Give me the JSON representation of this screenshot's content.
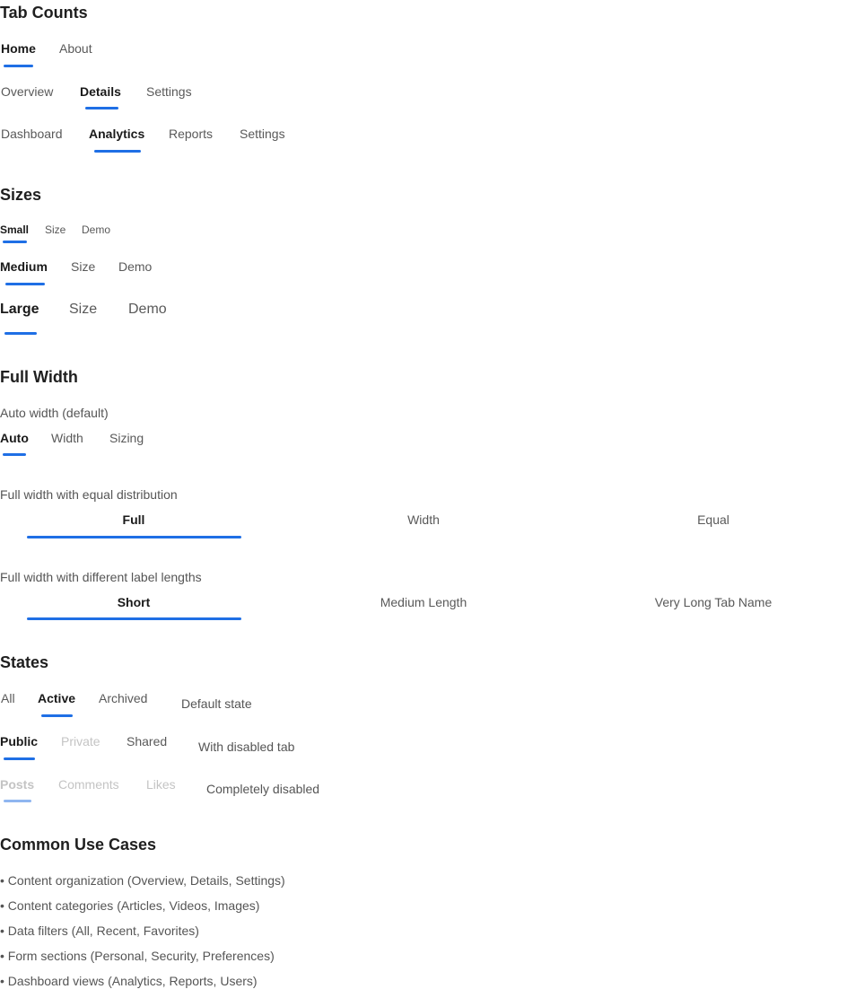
{
  "sections": {
    "tab_counts": "Tab Counts",
    "sizes": "Sizes",
    "full_width": "Full Width",
    "states": "States",
    "use_cases": "Common Use Cases"
  },
  "tab_counts": {
    "row2": [
      "Home",
      "About"
    ],
    "row3": [
      "Overview",
      "Details",
      "Settings"
    ],
    "row4": [
      "Dashboard",
      "Analytics",
      "Reports",
      "Settings"
    ]
  },
  "sizes": {
    "small": [
      "Small",
      "Size",
      "Demo"
    ],
    "medium": [
      "Medium",
      "Size",
      "Demo"
    ],
    "large": [
      "Large",
      "Size",
      "Demo"
    ]
  },
  "full_width": {
    "auto_label": "Auto width (default)",
    "auto_tabs": [
      "Auto",
      "Width",
      "Sizing"
    ],
    "equal_label": "Full width with equal distribution",
    "equal_tabs": [
      "Full",
      "Width",
      "Equal"
    ],
    "diff_label": "Full width with different label lengths",
    "diff_tabs": [
      "Short",
      "Medium Length",
      "Very Long Tab Name"
    ]
  },
  "states": {
    "default_tabs": [
      "All",
      "Active",
      "Archived"
    ],
    "default_label": "Default state",
    "disabled_tabs": [
      "Public",
      "Private",
      "Shared"
    ],
    "disabled_label": "With disabled tab",
    "all_disabled_tabs": [
      "Posts",
      "Comments",
      "Likes"
    ],
    "all_disabled_label": "Completely disabled"
  },
  "use_cases": [
    "• Content organization (Overview, Details, Settings)",
    "• Content categories (Articles, Videos, Images)",
    "• Data filters (All, Recent, Favorites)",
    "• Form sections (Personal, Security, Preferences)",
    "• Dashboard views (Analytics, Reports, Users)"
  ],
  "colors": {
    "accent": "#1f6fe5",
    "accent_disabled": "#8fb6f0",
    "text": "#1f1f1f",
    "muted": "#595959",
    "disabled": "#c4c4c4"
  }
}
